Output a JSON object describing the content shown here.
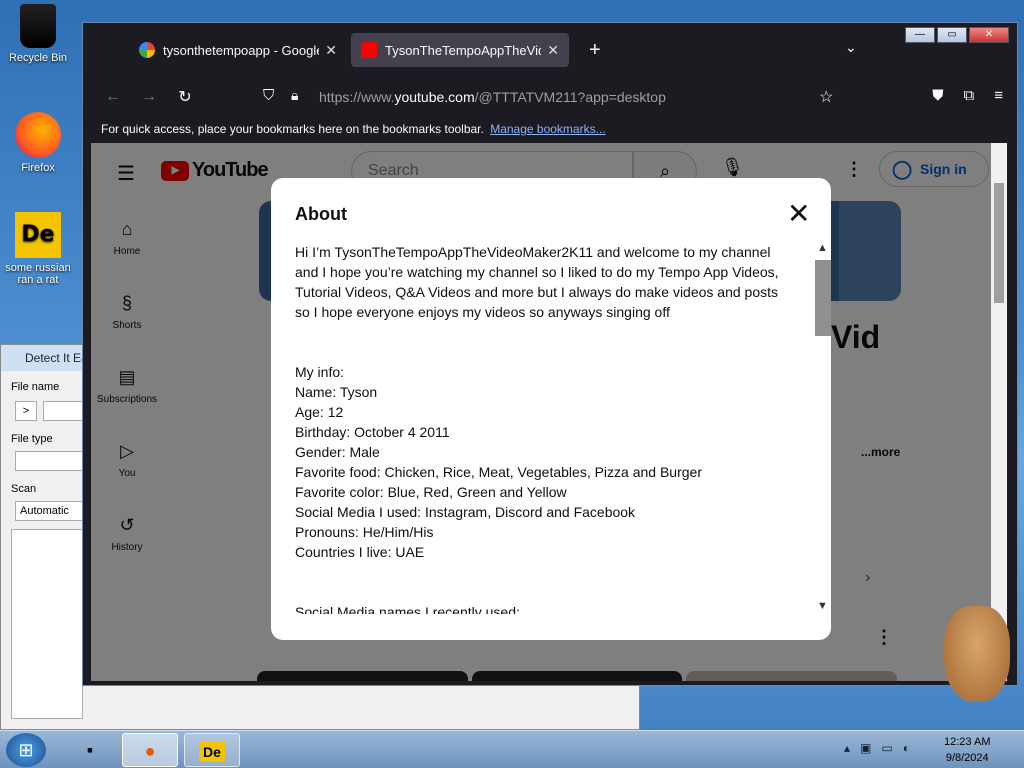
{
  "desktop": {
    "icons": [
      {
        "label": "Recycle Bin",
        "icon": "recycle-bin-icon"
      },
      {
        "label": "Firefox",
        "icon": "firefox-icon"
      },
      {
        "label": "some russian ran a rat",
        "icon": "detect-it-easy-icon"
      }
    ],
    "die_window": {
      "title": "Detect It Ea",
      "file_name_label": "File name",
      "browse_label": ">",
      "file_type_label": "File type",
      "scan_label": "Scan",
      "scan_value": "Automatic"
    }
  },
  "browser": {
    "tabs": [
      {
        "title": "tysonthetempoapp - Google Se",
        "icon": "google-icon"
      },
      {
        "title": "TysonTheTempoAppTheVideoM",
        "icon": "youtube-icon"
      }
    ],
    "new_tab": "+",
    "url_prefix": "https://www.",
    "url_domain": "youtube.com",
    "url_path": "/@TTTATVM211?app=desktop",
    "bookmarks_hint": "For quick access, place your bookmarks here on the bookmarks toolbar.",
    "bookmarks_link": "Manage bookmarks..."
  },
  "youtube": {
    "logo_text": "YouTube",
    "search_placeholder": "Search",
    "sign_in": "Sign in",
    "sidebar": [
      {
        "label": "Home",
        "icon": "home-icon"
      },
      {
        "label": "Shorts",
        "icon": "shorts-icon"
      },
      {
        "label": "Subscriptions",
        "icon": "subscriptions-icon"
      },
      {
        "label": "You",
        "icon": "you-icon"
      },
      {
        "label": "History",
        "icon": "history-icon"
      }
    ],
    "behind_title": "Vid",
    "behind_more": "...more"
  },
  "about": {
    "title": "About",
    "intro": "Hi I’m TysonTheTempoAppTheVideoMaker2K11 and welcome to my channel and I hope you’re watching my channel so I liked to do my Tempo App Videos, Tutorial Videos, Q&A Videos and more but I always do make videos and posts so I hope everyone enjoys my videos so anyways singing off",
    "info_lines": [
      "My info:",
      "Name: Tyson",
      "Age: 12",
      "Birthday: October 4 2011",
      "Gender: Male",
      "Favorite food: Chicken, Rice, Meat, Vegetables, Pizza and Burger",
      "Favorite color: Blue, Red, Green and Yellow",
      "Social Media I used: Instagram, Discord and Facebook",
      "Pronouns: He/Him/His",
      "Countries I live: UAE"
    ],
    "social_heading": "Social Media names I recently used:"
  },
  "taskbar": {
    "time": "12:23 AM",
    "date": "9/8/2024"
  }
}
